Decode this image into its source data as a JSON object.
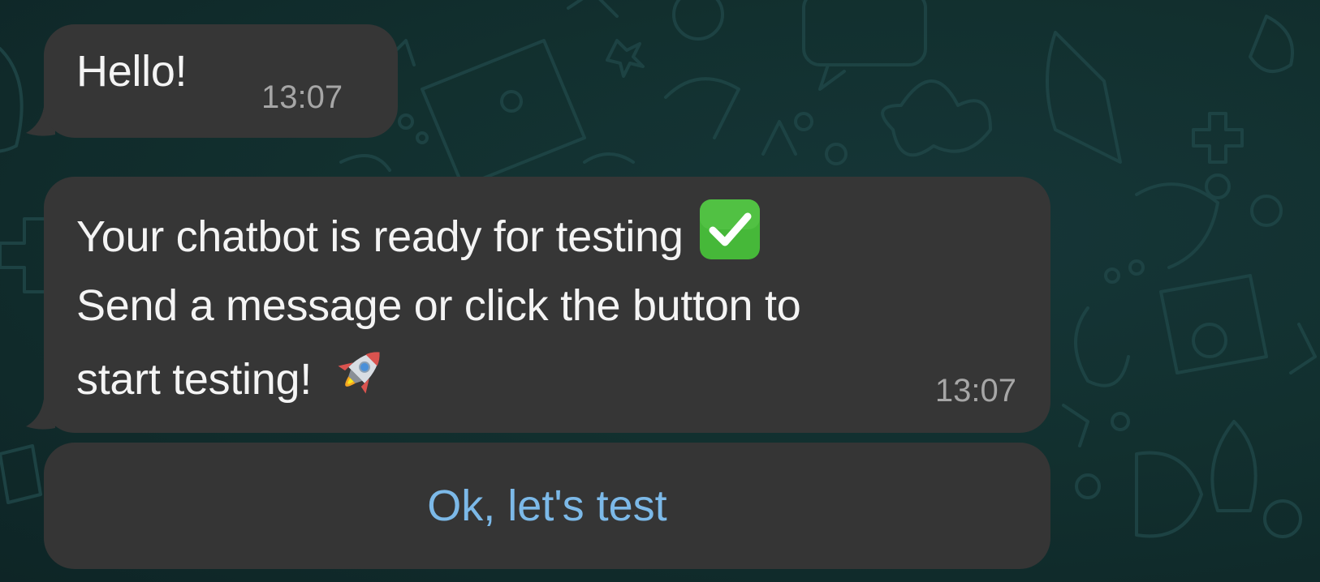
{
  "chat": {
    "messages": [
      {
        "text": "Hello!",
        "time": "13:07"
      },
      {
        "lines": [
          "Your chatbot is ready for testing",
          "Send a message or click the button to",
          "start testing!"
        ],
        "line1_emoji": "white-check-mark",
        "line3_emoji": "rocket",
        "time": "13:07"
      }
    ],
    "quick_reply_button": {
      "label": "Ok, let's test"
    }
  },
  "colors": {
    "background": "#12302f",
    "bubble": "#363636",
    "message_text": "#f4f4f4",
    "timestamp": "#a6a6a6",
    "button_text": "#7cb9e8",
    "check_emoji": "#46b839"
  }
}
